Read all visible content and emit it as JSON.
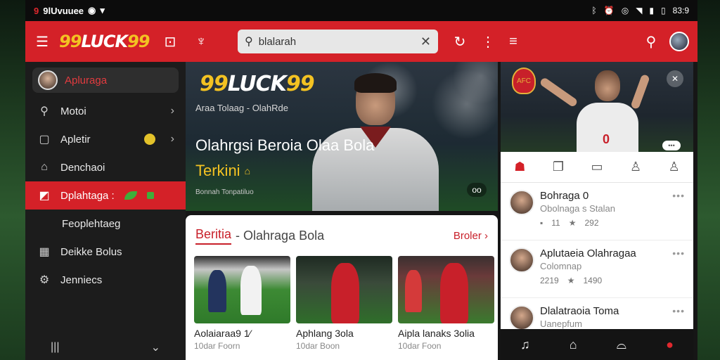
{
  "status_bar": {
    "carrier": "9lUvuuee",
    "time": "83:9",
    "icons": [
      "bluetooth-icon",
      "alarm-icon",
      "sync-icon",
      "wifi-icon",
      "signal-icon",
      "battery-icon"
    ]
  },
  "header": {
    "logo_yellow": "99",
    "logo_white": "LUCK",
    "logo_yellow2": "99",
    "search_value": "blalarah",
    "accent": "#d42128"
  },
  "sidebar": {
    "profile_label": "Apluraga",
    "items": [
      {
        "label": "Motoi",
        "icon": "search-icon"
      },
      {
        "label": "Apletir",
        "icon": "file-icon"
      },
      {
        "label": "Denchaoi",
        "icon": "home-icon"
      },
      {
        "label": "Dplahtaga :",
        "icon": "chart-icon"
      },
      {
        "label": "Feoplehtaeg",
        "icon": ""
      },
      {
        "label": "Deikke Bolus",
        "icon": "grid-icon"
      },
      {
        "label": "Jenniecs",
        "icon": "gear-icon"
      }
    ]
  },
  "hero": {
    "logo_yellow": "99",
    "logo_white": "LUCK",
    "logo_yellow2": "99",
    "subtitle": "Araa Tolaag - OlahRde",
    "headline": "Olahrgsi Beroia Olaa Bola",
    "headline2": "Terkini",
    "meta": "Bonnah Tonpatiluo",
    "more": "oo"
  },
  "news": {
    "title_accent": "Beritia",
    "title_rest": "- Olahraga Bola",
    "more": "Broler",
    "cards": [
      {
        "title": "Aolaiaraa9 1⁄",
        "sub": "10dar Foorn"
      },
      {
        "title": "Aphlang 3ola",
        "sub": "10dar Boon"
      },
      {
        "title": "Aipla lanaks 3olia",
        "sub": "10dar Foon"
      }
    ]
  },
  "right_panel": {
    "crest": "AFC",
    "player_number": "0",
    "list": [
      {
        "name": "Bohraga 0",
        "sub": "Obolnaga s Stalan",
        "stat1": "11",
        "stat2": "292"
      },
      {
        "name": "Aplutaeia Olahragaa",
        "sub": "Colomnap",
        "stat1": "2219",
        "stat2": "1490"
      },
      {
        "name": "Dlalatraoia Toma",
        "sub": "Uanepfum",
        "stat1": "",
        "stat2": ""
      }
    ]
  }
}
